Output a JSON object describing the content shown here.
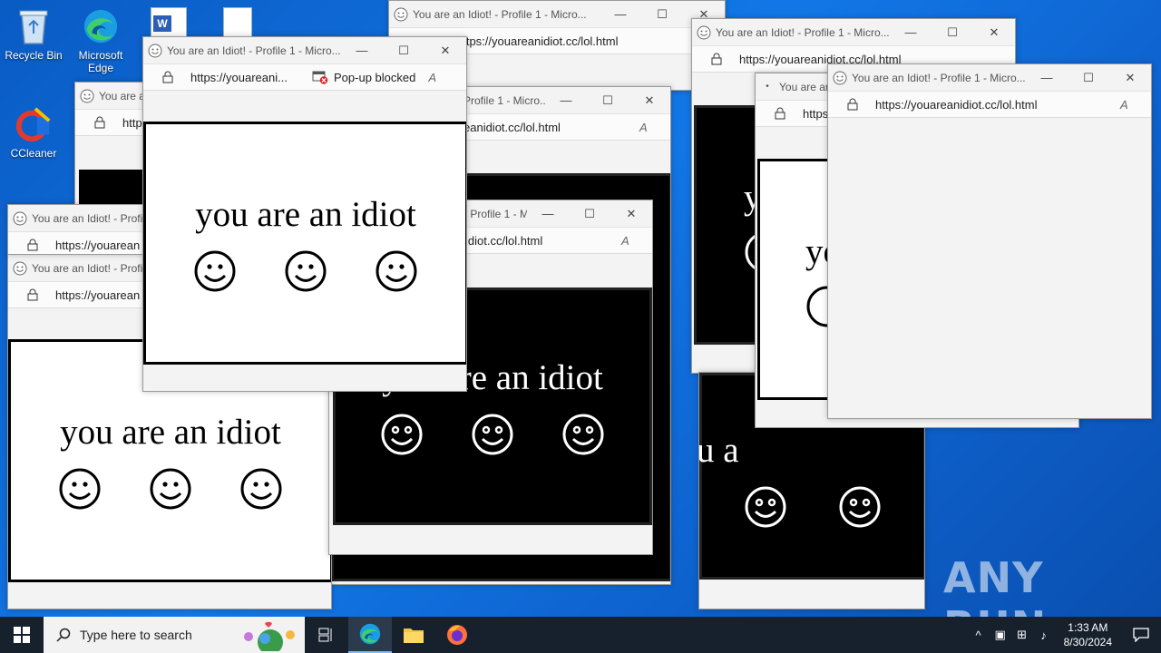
{
  "desktop": {
    "icons": [
      {
        "label": "Recycle Bin",
        "icon": "recycle-bin-icon"
      },
      {
        "label": "Microsoft Edge",
        "icon": "edge-icon"
      },
      {
        "label": "CCleaner",
        "icon": "ccleaner-icon"
      }
    ]
  },
  "window": {
    "title": "You are an Idiot! - Profile 1 - Micro...",
    "title_partial": "You are an Idiot! - Profil",
    "title_partial_mid": "Profile 1 - Micro...",
    "title_partial_mid2": "- Profile 1 - Micro...",
    "title_partial_short": "You are an",
    "url": "https://youareanidiot.cc/lol.html",
    "url_short": "https://youareani...",
    "url_partial": "https://youarean",
    "url_partial2": "eanidiot.cc/lol.html",
    "url_partial3": "idiot.cc/lol.html",
    "url_partial4": "https:",
    "url_partial5": "http",
    "popup_blocked": "Pop-up blocked",
    "page_text": "you are an idiot",
    "page_text_fragment_a": "yo",
    "page_text_fragment_b": "y",
    "page_text_fragment_c": "u a"
  },
  "taskbar": {
    "search_placeholder": "Type here to search",
    "time": "1:33 AM",
    "date": "8/30/2024"
  },
  "watermark": "ANY RUN",
  "colors": {
    "desktop_blue": "#1277e6",
    "taskbar": "#17212e",
    "window_chrome": "#f3f3f3"
  }
}
